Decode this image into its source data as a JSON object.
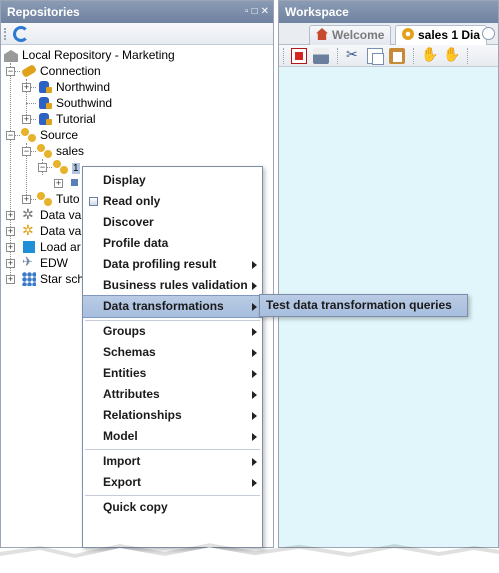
{
  "repositories_panel": {
    "title": "Repositories",
    "controls": [
      "restore-icon",
      "maximize-icon",
      "close-icon"
    ]
  },
  "workspace_panel": {
    "title": "Workspace",
    "tabs": [
      {
        "label": "Welcome",
        "icon": "home-icon",
        "active": false
      },
      {
        "label": "sales 1 Dia",
        "icon": "gear-icon",
        "active": true
      }
    ]
  },
  "tree": {
    "root": "Local Repository - Marketing",
    "connection": "Connection",
    "connection_items": [
      "Northwind",
      "Southwind",
      "Tutorial"
    ],
    "source": "Source",
    "source_sales": "sales",
    "source_sales_child": "1",
    "source_tutorial": "Tuto",
    "data_va_1": "Data va",
    "data_va_2": "Data va",
    "load": "Load ar",
    "edw": "EDW",
    "star": "Star sch"
  },
  "context_menu": {
    "items": [
      {
        "label": "Display",
        "submenu": false
      },
      {
        "label": "Read only",
        "submenu": false,
        "checkbox": true
      },
      {
        "label": "Discover",
        "submenu": false
      },
      {
        "label": "Profile data",
        "submenu": false
      },
      {
        "label": "Data profiling result",
        "submenu": true
      },
      {
        "label": "Business rules validation",
        "submenu": true
      },
      {
        "label": "Data transformations",
        "submenu": true,
        "highlighted": true
      },
      {
        "label": "Groups",
        "submenu": true
      },
      {
        "label": "Schemas",
        "submenu": true
      },
      {
        "label": "Entities",
        "submenu": true
      },
      {
        "label": "Attributes",
        "submenu": true
      },
      {
        "label": "Relationships",
        "submenu": true
      },
      {
        "label": "Model",
        "submenu": true
      },
      {
        "label": "Import",
        "submenu": true
      },
      {
        "label": "Export",
        "submenu": true
      },
      {
        "label": "Quick copy",
        "submenu": false
      }
    ],
    "submenu_item": "Test data transformation queries"
  },
  "colors": {
    "titlebar": "#7b8da9",
    "highlight": "#b0c4e2",
    "canvas": "#e0f6fa"
  }
}
